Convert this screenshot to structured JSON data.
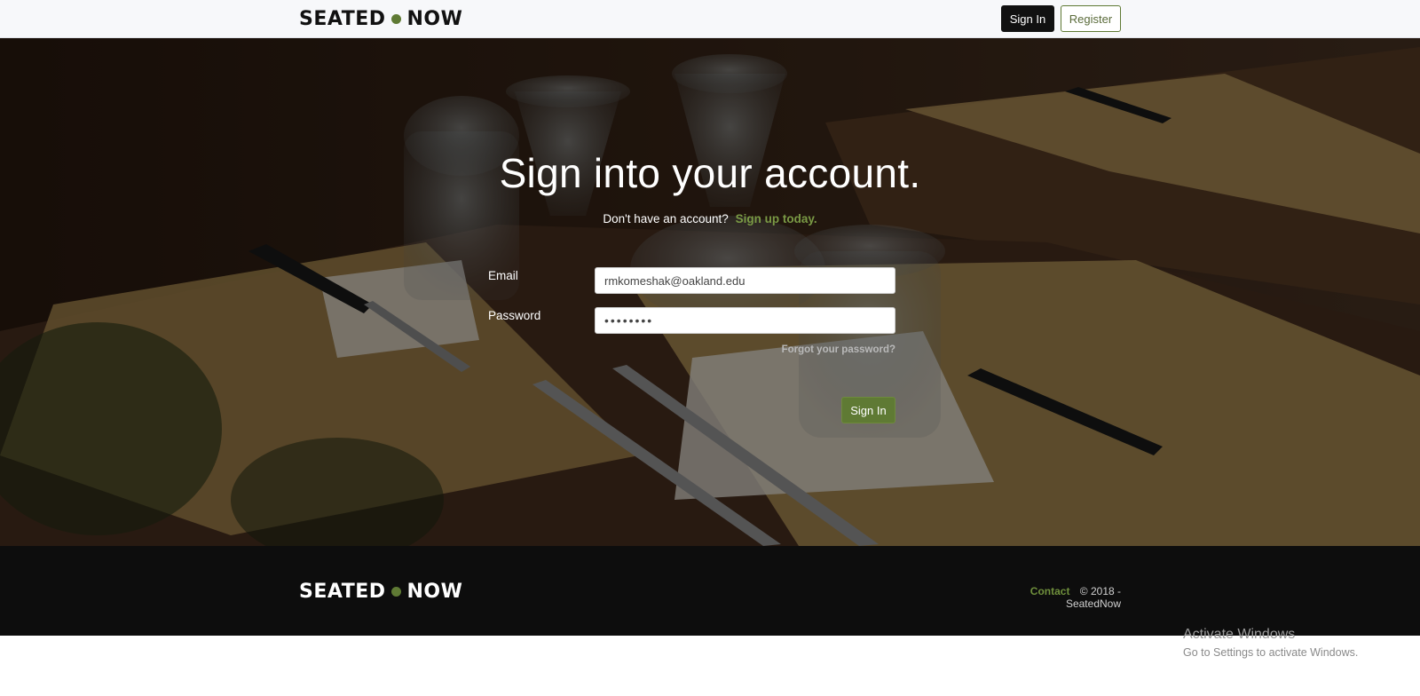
{
  "brand": {
    "name_left": "SEATED",
    "name_right": "NOW",
    "accent_color": "#5f7a34"
  },
  "navbar": {
    "signin_label": "Sign In",
    "register_label": "Register"
  },
  "hero": {
    "title": "Sign into your account.",
    "no_account_text": "Don't have an account?",
    "signup_link": "Sign up today."
  },
  "form": {
    "email_label": "Email",
    "email_value": "rmkomeshak@oakland.edu",
    "password_label": "Password",
    "password_value": "••••••••",
    "forgot_link": "Forgot your password?",
    "submit_label": "Sign In"
  },
  "footer": {
    "contact_link": "Contact",
    "copyright": "© 2018 - SeatedNow"
  },
  "watermark": {
    "line1": "Activate Windows",
    "line2": "Go to Settings to activate Windows."
  },
  "icons": {
    "logo_dot": "dot-icon"
  }
}
